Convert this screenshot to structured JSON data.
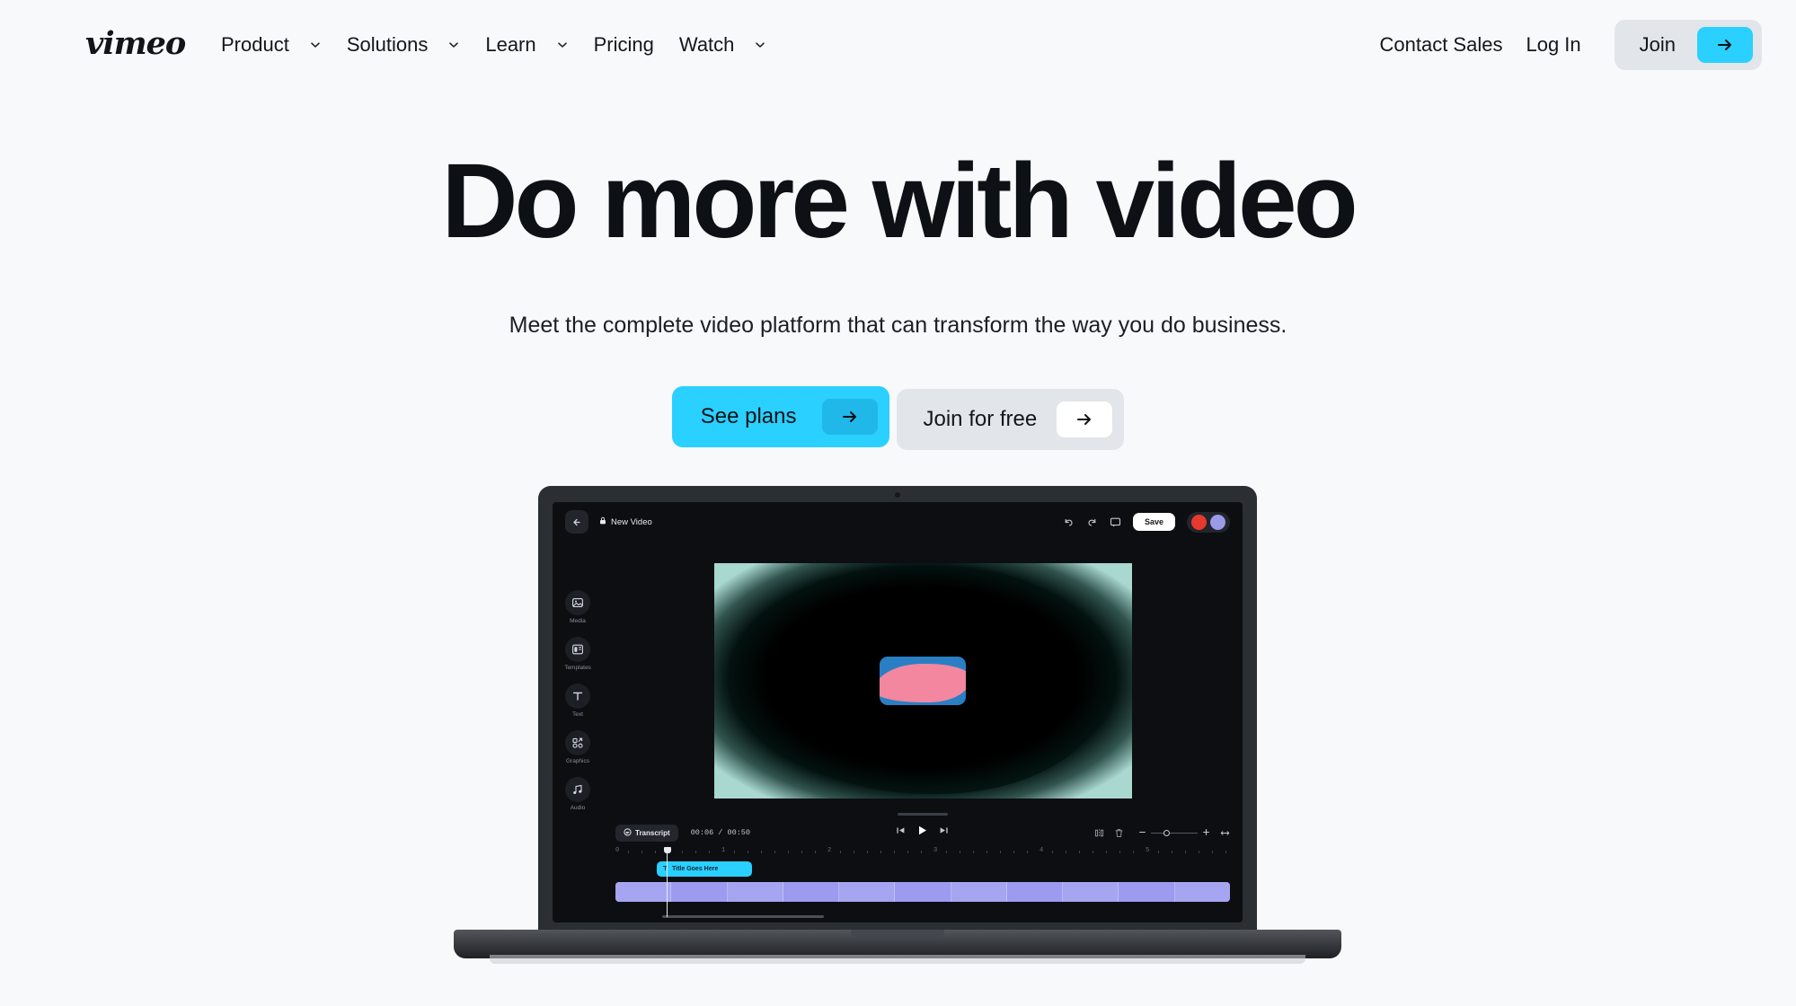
{
  "brand": {
    "logo_text": "vimeo",
    "accent": "#2ad0ff",
    "bg": "#f8f9fb",
    "text": "#0d1116"
  },
  "header": {
    "nav_items": [
      {
        "label": "Product",
        "has_caret": true
      },
      {
        "label": "Solutions",
        "has_caret": true
      },
      {
        "label": "Learn",
        "has_caret": true
      },
      {
        "label": "Pricing",
        "has_caret": false
      },
      {
        "label": "Watch",
        "has_caret": true
      }
    ],
    "contact_sales": "Contact Sales",
    "log_in": "Log In",
    "join": "Join"
  },
  "hero": {
    "title": "Do more with video",
    "subtitle": "Meet the complete video platform that can transform the way you do business.",
    "cta_primary": "See plans",
    "cta_secondary": "Join for free"
  },
  "editor": {
    "video_title": "New Video",
    "save_label": "Save",
    "tools": [
      {
        "label": "Media",
        "icon": "media-icon"
      },
      {
        "label": "Templates",
        "icon": "templates-icon"
      },
      {
        "label": "Text",
        "icon": "text-icon"
      },
      {
        "label": "Graphics",
        "icon": "graphics-icon"
      },
      {
        "label": "Audio",
        "icon": "audio-icon"
      }
    ],
    "transcript_label": "Transcript",
    "timecode": "00:06 / 00:50",
    "clip_label": "Title Goes Here",
    "ruler_marks": [
      "0",
      "1",
      "2",
      "3",
      "4",
      "5"
    ],
    "avatar_colors": [
      "#e8392f",
      "#9a9ae8"
    ]
  }
}
